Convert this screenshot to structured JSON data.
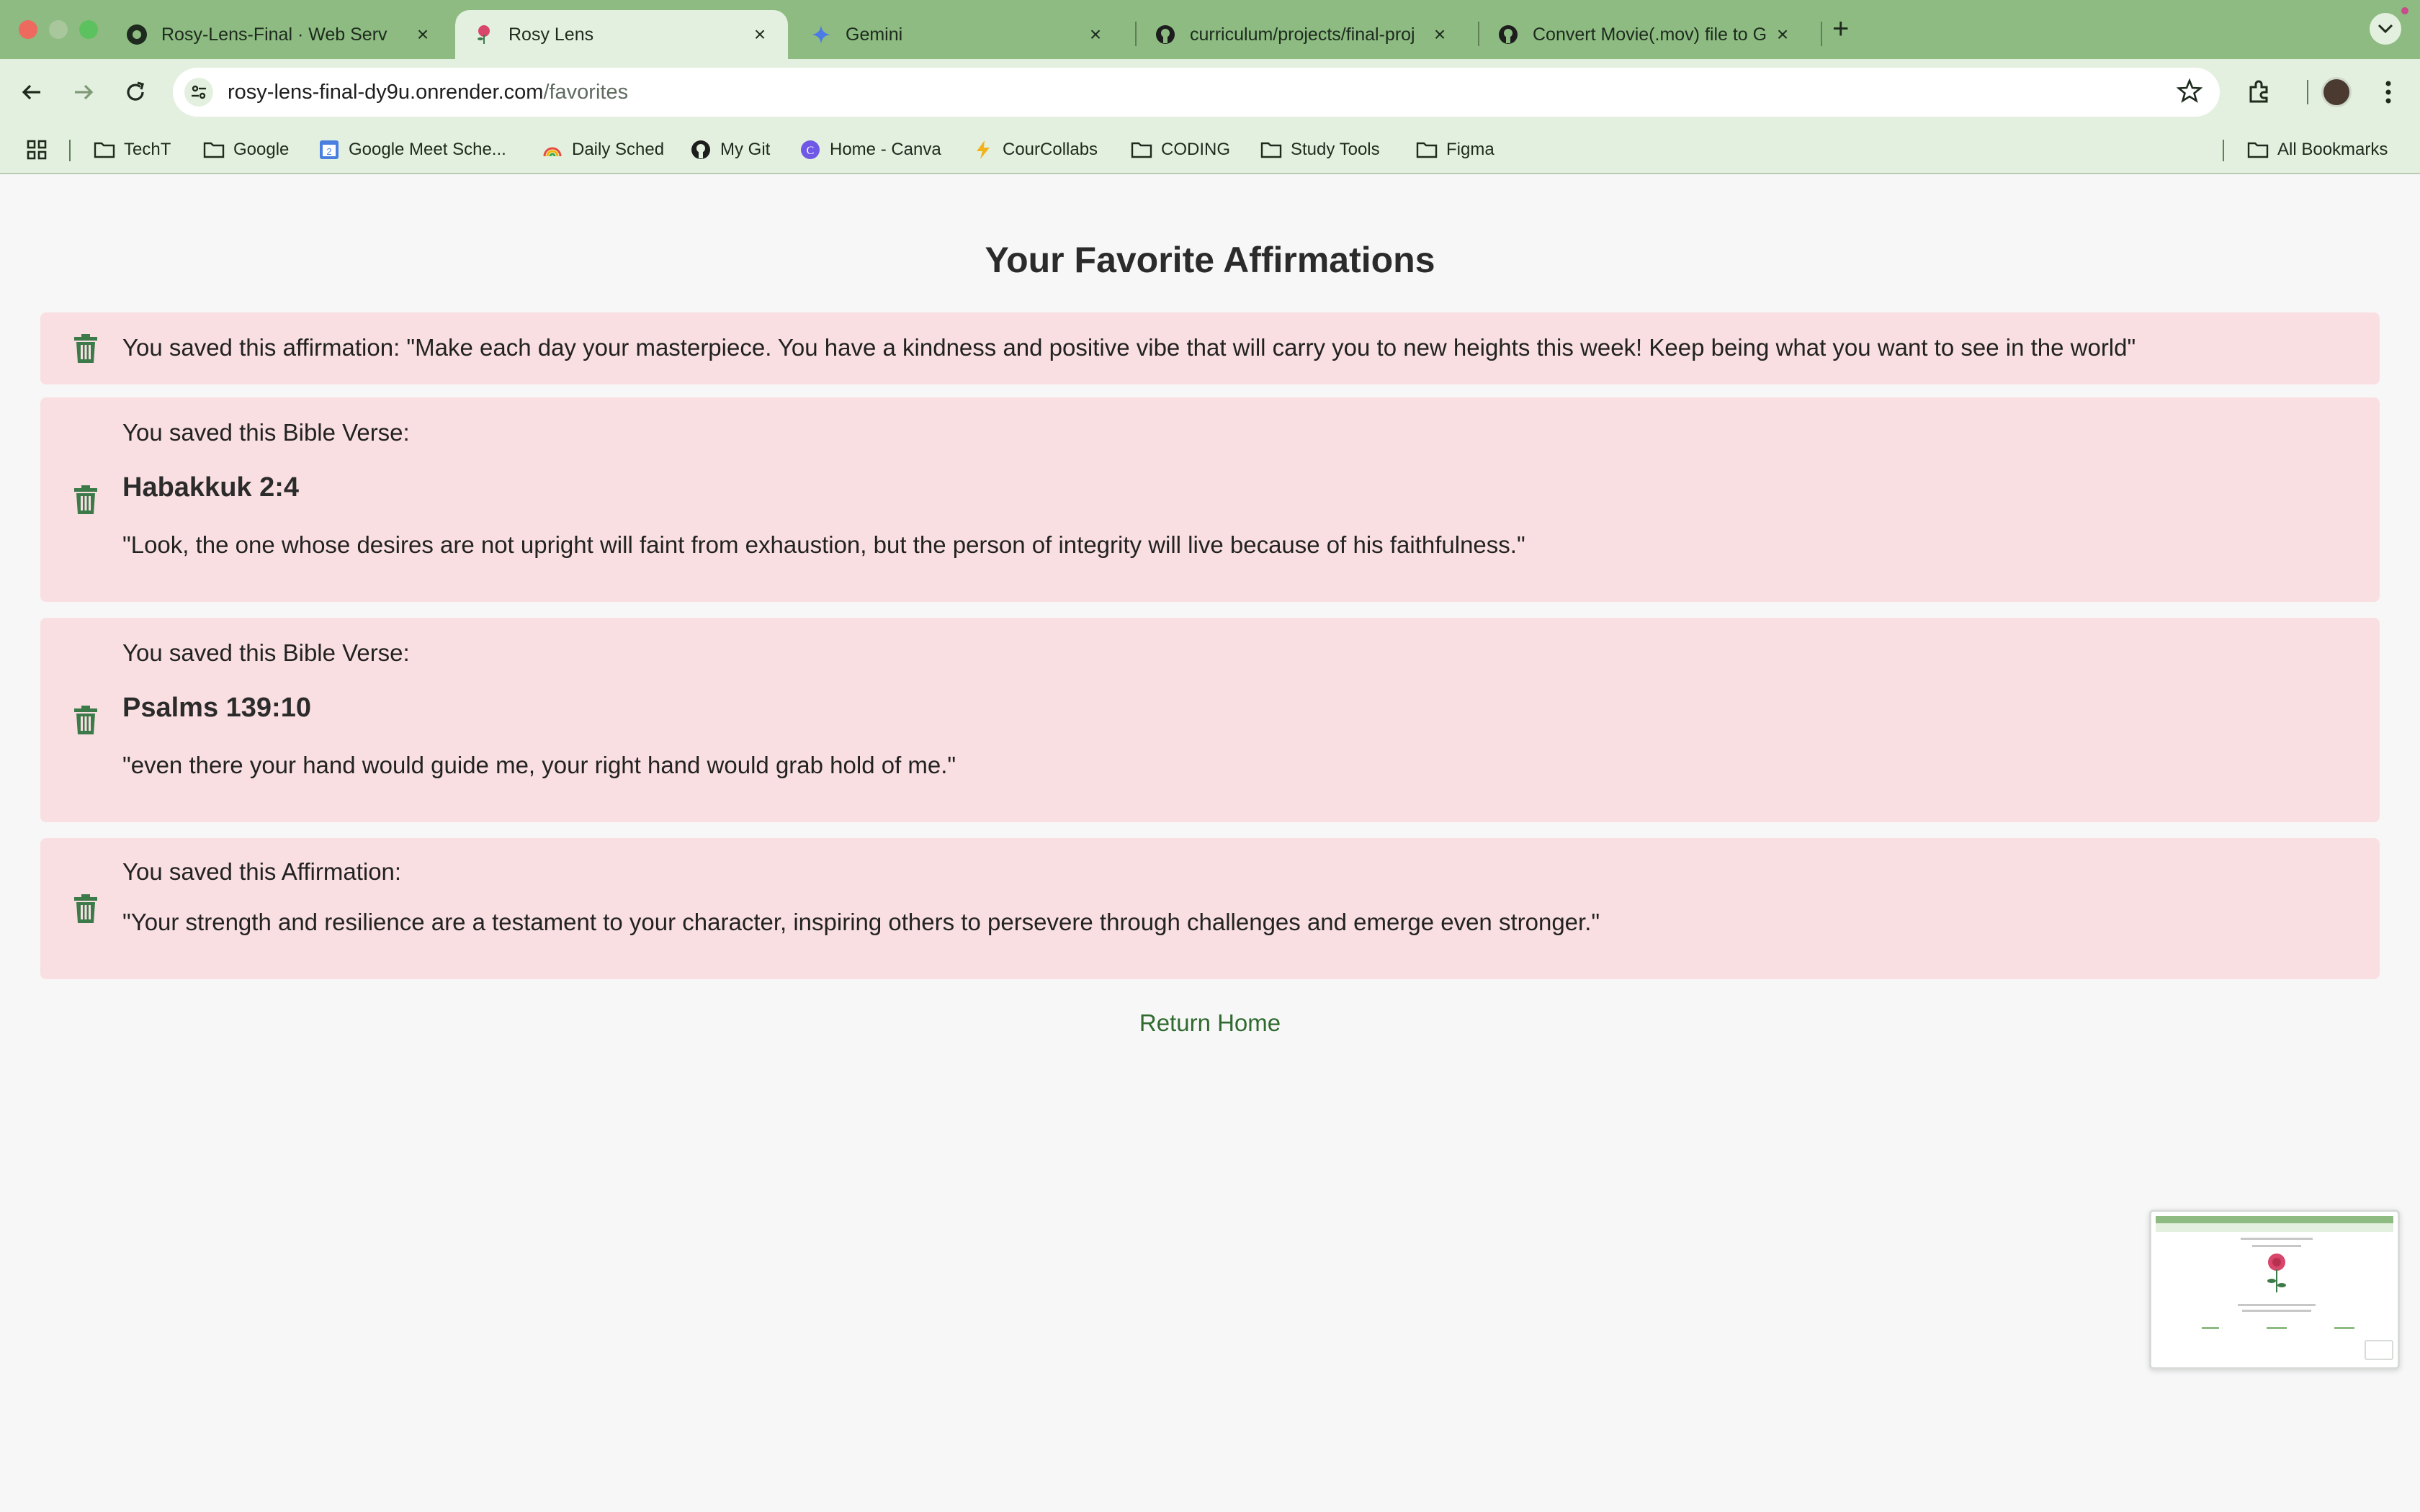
{
  "browser": {
    "tabs": [
      {
        "title": "Rosy-Lens-Final · Web Serv",
        "icon": "render-icon",
        "active": false
      },
      {
        "title": "Rosy Lens",
        "icon": "rose-favicon",
        "active": true
      },
      {
        "title": "Gemini",
        "icon": "gemini-icon",
        "active": false
      },
      {
        "title": "curriculum/projects/final-proj",
        "icon": "github-icon",
        "active": false
      },
      {
        "title": "Convert Movie(.mov) file to G",
        "icon": "github-icon",
        "active": false
      }
    ],
    "new_tab": "+",
    "url": {
      "host": "rosy-lens-final-dy9u.onrender.com",
      "path": "/favorites"
    },
    "bookmarks": [
      {
        "label": "TechT",
        "icon": "folder-icon"
      },
      {
        "label": "Google",
        "icon": "folder-icon"
      },
      {
        "label": "Google Meet Sche...",
        "icon": "calendar-icon"
      },
      {
        "label": "Daily Sched",
        "icon": "rainbow-icon"
      },
      {
        "label": "My Git",
        "icon": "github-icon"
      },
      {
        "label": "Home - Canva",
        "icon": "canva-icon"
      },
      {
        "label": "CourCollabs",
        "icon": "bolt-icon"
      },
      {
        "label": "CODING",
        "icon": "folder-icon"
      },
      {
        "label": "Study Tools",
        "icon": "folder-icon"
      },
      {
        "label": "Figma",
        "icon": "folder-icon"
      }
    ],
    "all_bookmarks": "All Bookmarks"
  },
  "page": {
    "title": "Your Favorite Affirmations",
    "favorites": [
      {
        "kind": "affirmation-inline",
        "text": "You saved this affirmation: \"Make each day your masterpiece. You have a kindness and positive vibe that will carry you to new heights this week! Keep being what you want to see in the world\""
      },
      {
        "kind": "verse",
        "heading": "You saved this Bible Verse:",
        "reference": "Habakkuk 2:4",
        "text": "\"Look, the one whose desires are not upright will faint from exhaustion, but the person of integrity will live because of his faithfulness.\""
      },
      {
        "kind": "verse",
        "heading": "You saved this Bible Verse:",
        "reference": "Psalms 139:10",
        "text": "\"even there your hand would guide me, your right hand would grab hold of me.\""
      },
      {
        "kind": "affirmation",
        "heading": "You saved this Affirmation:",
        "text": "\"Your strength and resilience are a testament to your character, inspiring others to persevere through challenges and emerge even stronger.\""
      }
    ],
    "return_home": "Return Home"
  },
  "colors": {
    "chrome": "#8dbb82",
    "toolbar": "#e4f0df",
    "card": "#f9dfe2",
    "trash": "#3d7a4a",
    "link": "#2f6a2f"
  }
}
